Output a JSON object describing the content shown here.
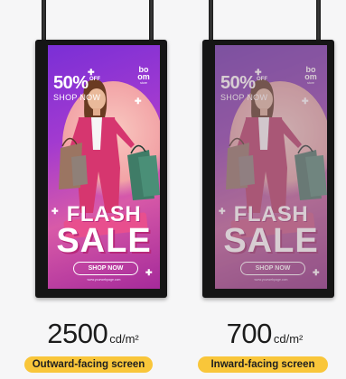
{
  "displays": [
    {
      "brightness_value": "2500",
      "brightness_unit": "cd/m²",
      "label": "Outward-facing screen",
      "ad": {
        "discount": "50%",
        "off": "OFF",
        "shop_now_top": "SHOP NOW",
        "logo_line1": "bo",
        "logo_line2": "om",
        "logo_tag": "store",
        "flash": "FLASH",
        "sale": "SALE",
        "shop_now_button": "SHOP NOW",
        "url": "www.yourwebpage.com"
      }
    },
    {
      "brightness_value": "700",
      "brightness_unit": "cd/m²",
      "label": "Inward-facing screen",
      "ad": {
        "discount": "50%",
        "off": "OFF",
        "shop_now_top": "SHOP NOW",
        "logo_line1": "bo",
        "logo_line2": "om",
        "logo_tag": "store",
        "flash": "FLASH",
        "sale": "SALE",
        "shop_now_button": "SHOP NOW",
        "url": "www.yourwebpage.com"
      }
    }
  ],
  "colors": {
    "label_pill": "#f9c63a",
    "ad_purple": "#7a2fd6",
    "ad_pink": "#e84f8e",
    "bezel": "#151515"
  }
}
